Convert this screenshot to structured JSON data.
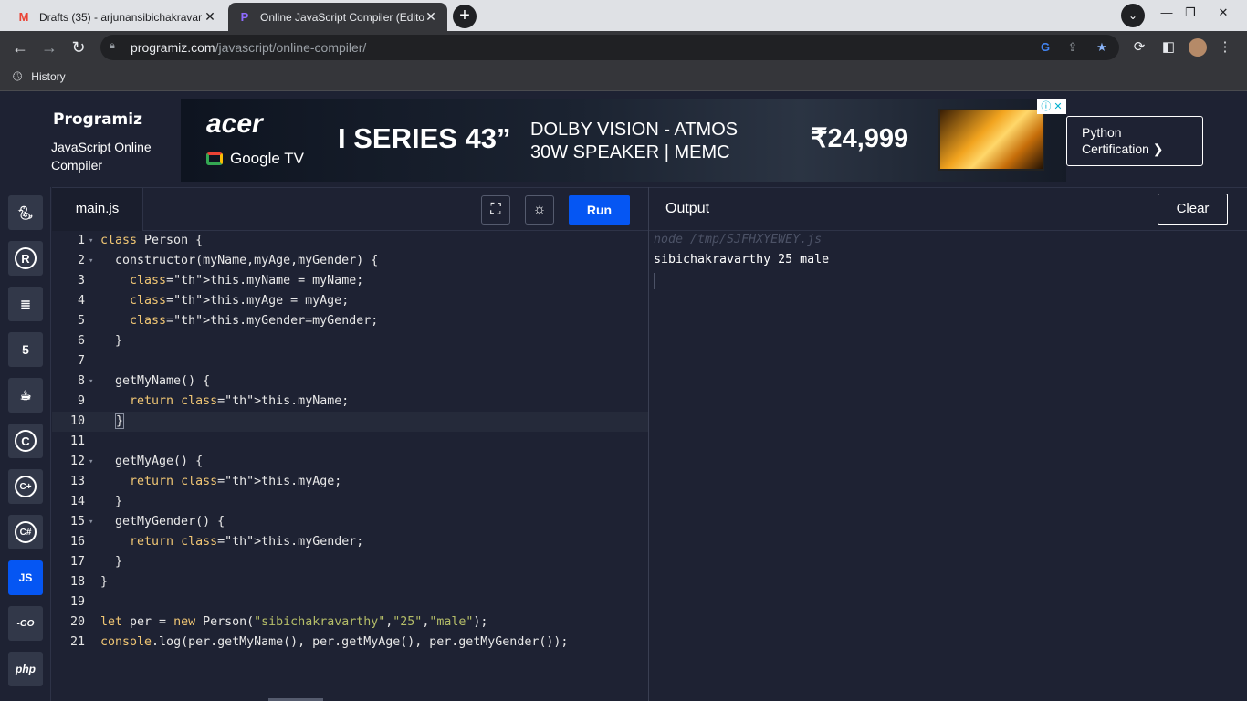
{
  "browser": {
    "tabs": [
      {
        "title": "Drafts (35) - arjunansibichakravar",
        "icon": "gmail-icon"
      },
      {
        "title": "Online JavaScript Compiler (Edito",
        "icon": "programiz-icon"
      }
    ],
    "url_host": "programiz.com",
    "url_path": "/javascript/online-compiler/",
    "bookmark_label": "History"
  },
  "header": {
    "logo": "Programiz",
    "page_title": "JavaScript Online Compiler",
    "cert_label": "Python Certification ❯"
  },
  "ad": {
    "brand": "acer",
    "partner": "Google TV",
    "series": "I SERIES 43”",
    "feature_1": "DOLBY VISION - ATMOS",
    "feature_2": "30W SPEAKER | MEMC",
    "price": "₹24,999"
  },
  "sidebar": {
    "languages": [
      "python",
      "r",
      "sql",
      "html",
      "java",
      "c",
      "cpp",
      "csharp",
      "js",
      "go",
      "php"
    ],
    "active": "js",
    "labels": {
      "c": "C",
      "cpp": "C+",
      "csharp": "C#",
      "js": "JS",
      "go": "-GO",
      "php": "php"
    }
  },
  "editor": {
    "file_name": "main.js",
    "run_label": "Run",
    "lines": [
      "class Person {",
      "  constructor(myName,myAge,myGender) {",
      "    this.myName = myName;",
      "    this.myAge = myAge;",
      "    this.myGender=myGender;",
      "  }",
      "",
      "  getMyName() {",
      "    return this.myName;",
      "  }",
      "",
      "  getMyAge() {",
      "    return this.myAge;",
      "  }",
      "  getMyGender() {",
      "    return this.myGender;",
      "  }",
      "}",
      "",
      "let per = new Person(\"sibichakravarthy\",\"25\",\"male\");",
      "console.log(per.getMyName(), per.getMyAge(), per.getMyGender());"
    ],
    "active_line": 10
  },
  "output": {
    "title": "Output",
    "clear_label": "Clear",
    "command": "node /tmp/SJFHXYEWEY.js",
    "result": "sibichakravarthy 25 male"
  },
  "colors": {
    "background": "#1e2233",
    "accent": "#0556f3",
    "keyword": "#f0c674",
    "string": "#b5bd68"
  }
}
